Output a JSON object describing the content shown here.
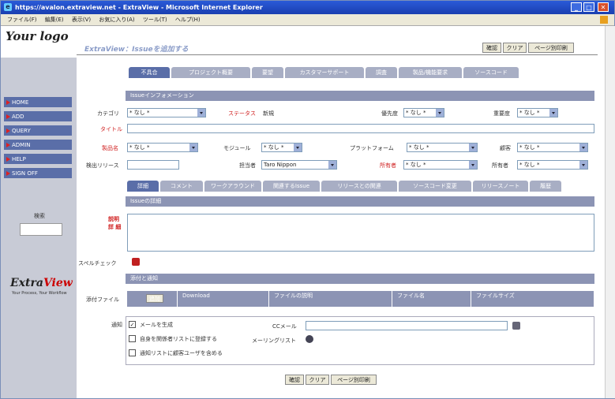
{
  "window": {
    "title": "https://avalon.extraview.net - ExtraView - Microsoft Internet Explorer",
    "controls": {
      "min": "_",
      "max": "□",
      "close": "✕"
    }
  },
  "menu": [
    "ファイル(F)",
    "編集(E)",
    "表示(V)",
    "お気に入り(A)",
    "ツール(T)",
    "ヘルプ(H)"
  ],
  "logo": {
    "your": "Your",
    "logo": "logo"
  },
  "page": {
    "title": "ExtraView：Issueを追加する"
  },
  "toolbar": {
    "confirm": "確認",
    "clear": "クリア",
    "layout": "ページ別印刷"
  },
  "top_tabs": [
    "不具合",
    "プロジェクト概要",
    "要望",
    "カスタマーサポート",
    "調査",
    "製品/機能要求",
    "ソースコード"
  ],
  "nav": [
    "HOME",
    "ADD",
    "QUERY",
    "ADMIN",
    "HELP",
    "SIGN OFF"
  ],
  "left": {
    "search_label": "検索"
  },
  "extraview": {
    "extra": "Extra",
    "view": "View",
    "tagline": "Your Process, Your Workflow"
  },
  "section_info": "Issueインフォメーション",
  "form": {
    "category_label": "カテゴリ",
    "category_value": "* なし *",
    "status_label": "ステータス",
    "status_value": "新規",
    "priority_label": "優先度",
    "priority_value": "* なし *",
    "severity_label": "重要度",
    "severity_value": "* なし *",
    "title_label": "タイトル",
    "product_label": "製品名",
    "product_value": "* なし *",
    "module_label": "モジュール",
    "module_value": "* なし *",
    "platform_label": "プラットフォーム",
    "platform_value": "* なし *",
    "customer_label": "顧客",
    "customer_value": "* なし *",
    "release_label": "検出リリース",
    "assigned_label": "担当者",
    "assigned_value": "Taro Nippon",
    "owner_label": "所有者",
    "owner_value": "* なし *",
    "owner2_label": "所有者",
    "owner2_value": "* なし *"
  },
  "bottom_tabs": [
    "詳細",
    "コメント",
    "ワークアラウンド",
    "関連するIssue",
    "リリースとの関連",
    "ソースコード変更",
    "リリースノート",
    "履歴"
  ],
  "section_details": "Issueの詳細",
  "details": {
    "label_line1": "説明",
    "label_line2": "詳 細"
  },
  "spellcheck": "スペルチェック",
  "section_attach": "添付と通知",
  "attachments": {
    "label": "添付ファイル",
    "add_button": "追加",
    "columns": [
      "Download",
      "ファイルの説明",
      "ファイル名",
      "ファイルサイズ"
    ]
  },
  "notify": {
    "label": "通知",
    "opt1": "メールを生成",
    "opt2": "自身を関係者リストに登録する",
    "opt3": "通知リストに顧客ユーザを含める",
    "cc_label": "CCメール",
    "mailing_label": "メーリングリスト"
  }
}
